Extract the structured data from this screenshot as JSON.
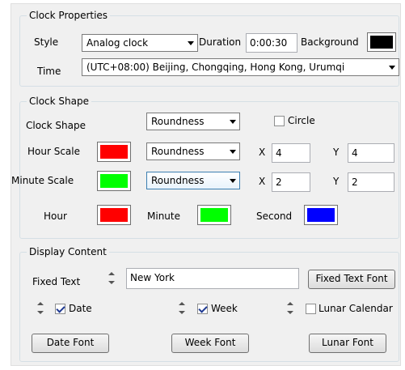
{
  "clock_properties": {
    "legend": "Clock Properties",
    "style_label": "Style",
    "style_value": "Analog clock",
    "duration_label": "Duration",
    "duration_value": "0:00:30",
    "background_label": "Background",
    "background_color": "#000000",
    "time_label": "Time",
    "time_value": "(UTC+08:00) Beijing, Chongqing, Hong Kong, Urumqi"
  },
  "clock_shape": {
    "legend": "Clock Shape",
    "shape_label": "Clock Shape",
    "shape_value": "Roundness",
    "circle_label": "Circle",
    "circle_checked": false,
    "hour_scale_label": "Hour Scale",
    "hour_scale_color": "#ff0000",
    "hour_scale_shape": "Roundness",
    "hour_x": "4",
    "hour_y": "4",
    "minute_scale_label": "Minute Scale",
    "minute_scale_color": "#00ff00",
    "minute_scale_shape": "Roundness",
    "minute_x": "2",
    "minute_y": "2",
    "x_label": "X",
    "y_label": "Y",
    "hour_label": "Hour",
    "hour_color": "#ff0000",
    "minute_label": "Minute",
    "minute_color": "#00ff00",
    "second_label": "Second",
    "second_color": "#0000ff"
  },
  "display_content": {
    "legend": "Display Content",
    "fixed_text_label": "Fixed Text",
    "fixed_text_value": "New York",
    "fixed_text_font_button": "Fixed Text Font",
    "date_label": "Date",
    "date_checked": true,
    "week_label": "Week",
    "week_checked": true,
    "lunar_label": "Lunar Calendar",
    "lunar_checked": false,
    "date_font_button": "Date Font",
    "week_font_button": "Week Font",
    "lunar_font_button": "Lunar Font"
  }
}
